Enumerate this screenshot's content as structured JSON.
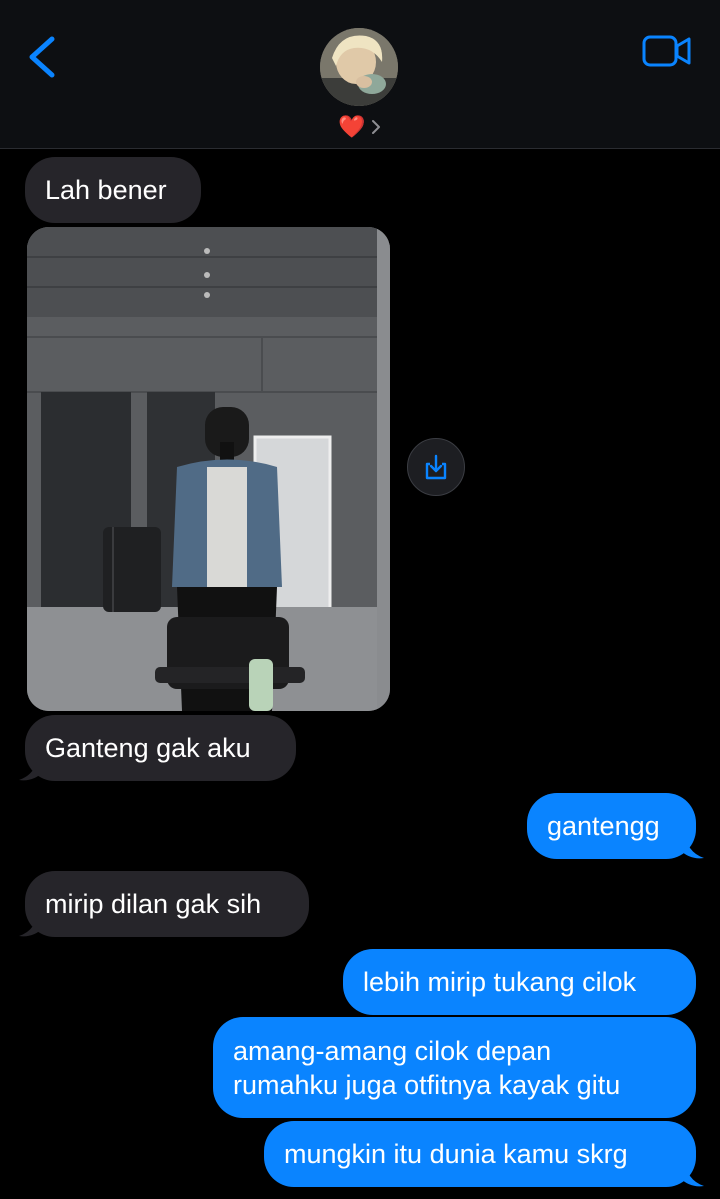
{
  "header": {
    "contact_name": "❤️",
    "back_icon": "chevron-left-icon",
    "video_icon": "video-camera-icon",
    "accent_color": "#0a84ff"
  },
  "messages": [
    {
      "direction": "incoming",
      "text": "Lah bener"
    },
    {
      "direction": "incoming",
      "type": "image",
      "image_description": "mirror selfie photo"
    },
    {
      "direction": "incoming",
      "text": "Ganteng gak aku"
    },
    {
      "direction": "outgoing",
      "text": "gantengg"
    },
    {
      "direction": "incoming",
      "text": "mirip dilan gak sih"
    },
    {
      "direction": "outgoing",
      "text": "lebih mirip tukang cilok"
    },
    {
      "direction": "outgoing",
      "lines": [
        "amang-amang cilok depan",
        "rumahku juga otfitnya kayak gitu"
      ]
    },
    {
      "direction": "outgoing",
      "text": "mungkin itu dunia kamu skrg"
    }
  ],
  "colors": {
    "incoming_bubble": "#26252a",
    "outgoing_bubble": "#0a84ff",
    "background": "#000000"
  }
}
